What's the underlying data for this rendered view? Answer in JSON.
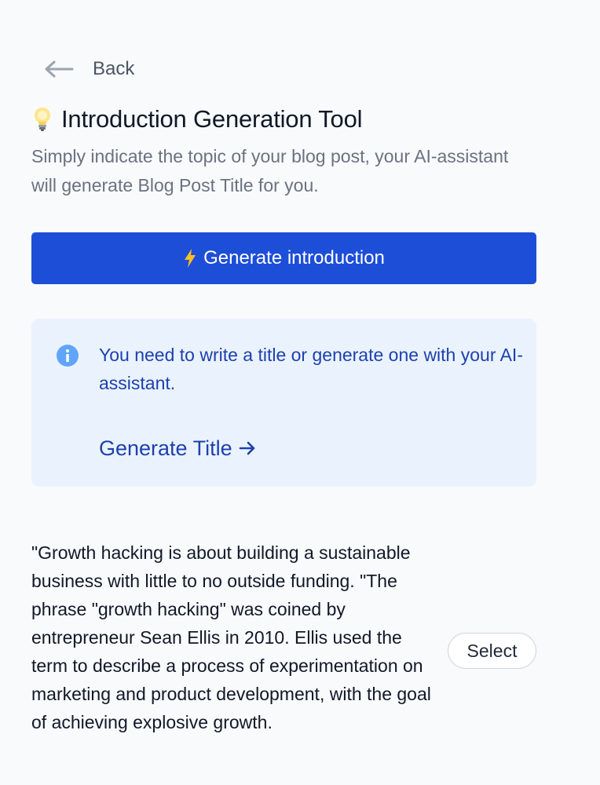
{
  "back": {
    "label": "Back",
    "icon": "arrow-left-icon"
  },
  "header": {
    "icon": "lightbulb-icon",
    "title": "Introduction Generation Tool",
    "subtitle": "Simply indicate the topic of your blog post, your AI-assistant will generate Blog Post Title for you."
  },
  "generate_button": {
    "icon": "lightning-icon",
    "label": "Generate introduction"
  },
  "alert": {
    "icon": "info-icon",
    "message": "You need to write a title or generate one with your AI-assistant.",
    "link_label": "Generate Title",
    "link_icon": "arrow-right-icon"
  },
  "result": {
    "text": "\"Growth hacking is about building a sustainable business with little to no outside funding. \"The phrase \"growth hacking\" was coined by entrepreneur Sean Ellis in 2010. Ellis used the term to describe a process of experimentation on marketing and product development, with the goal of achieving explosive growth.",
    "select_label": "Select"
  },
  "colors": {
    "background": "#f8fafc",
    "primary": "#1d4ed8",
    "alert_bg": "#eaf3fd",
    "alert_text": "#1e40af",
    "info_icon": "#60a5fa"
  }
}
